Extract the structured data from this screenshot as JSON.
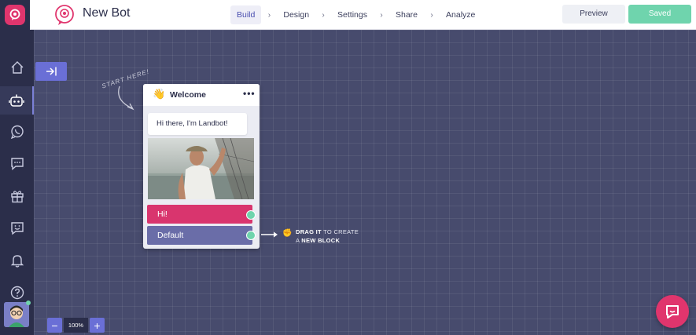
{
  "header": {
    "bot_title": "New Bot",
    "steps": [
      {
        "label": "Build",
        "active": true
      },
      {
        "label": "Design",
        "active": false
      },
      {
        "label": "Settings",
        "active": false
      },
      {
        "label": "Share",
        "active": false
      },
      {
        "label": "Analyze",
        "active": false
      }
    ],
    "step_separator": "›",
    "preview_label": "Preview",
    "saved_label": "Saved"
  },
  "sidebar": {
    "items": [
      {
        "name": "home",
        "icon": "home-icon",
        "active": false
      },
      {
        "name": "bots",
        "icon": "robot-icon",
        "active": true
      },
      {
        "name": "whatsapp",
        "icon": "whatsapp-icon",
        "active": false
      },
      {
        "name": "messages",
        "icon": "chat-icon",
        "active": false
      },
      {
        "name": "gifts",
        "icon": "gift-icon",
        "active": false
      },
      {
        "name": "inbox",
        "icon": "smile-message-icon",
        "active": false
      },
      {
        "name": "notifications",
        "icon": "bell-icon",
        "active": false
      },
      {
        "name": "help",
        "icon": "help-icon",
        "active": false
      }
    ]
  },
  "canvas": {
    "start_hint": "START HERE!",
    "welcome_block": {
      "emoji": "👋",
      "title": "Welcome",
      "menu": "•••",
      "message": "Hi there, I'm Landbot!",
      "options": [
        {
          "label": "Hi!",
          "color": "#d9356e"
        },
        {
          "label": "Default",
          "color": "#6a6da8"
        }
      ]
    },
    "drag_hint": {
      "hand": "✊",
      "bold1": "DRAG IT",
      "text1": " TO CREATE",
      "text2": "A ",
      "bold2": "NEW BLOCK"
    }
  },
  "zoom": {
    "minus": "−",
    "level": "100%",
    "plus": "+"
  },
  "colors": {
    "accent": "#6a6fd6",
    "brand": "#e0356d",
    "saved": "#6fd4ad",
    "sidebar": "#2b2e4a",
    "canvas": "#474b6d"
  }
}
